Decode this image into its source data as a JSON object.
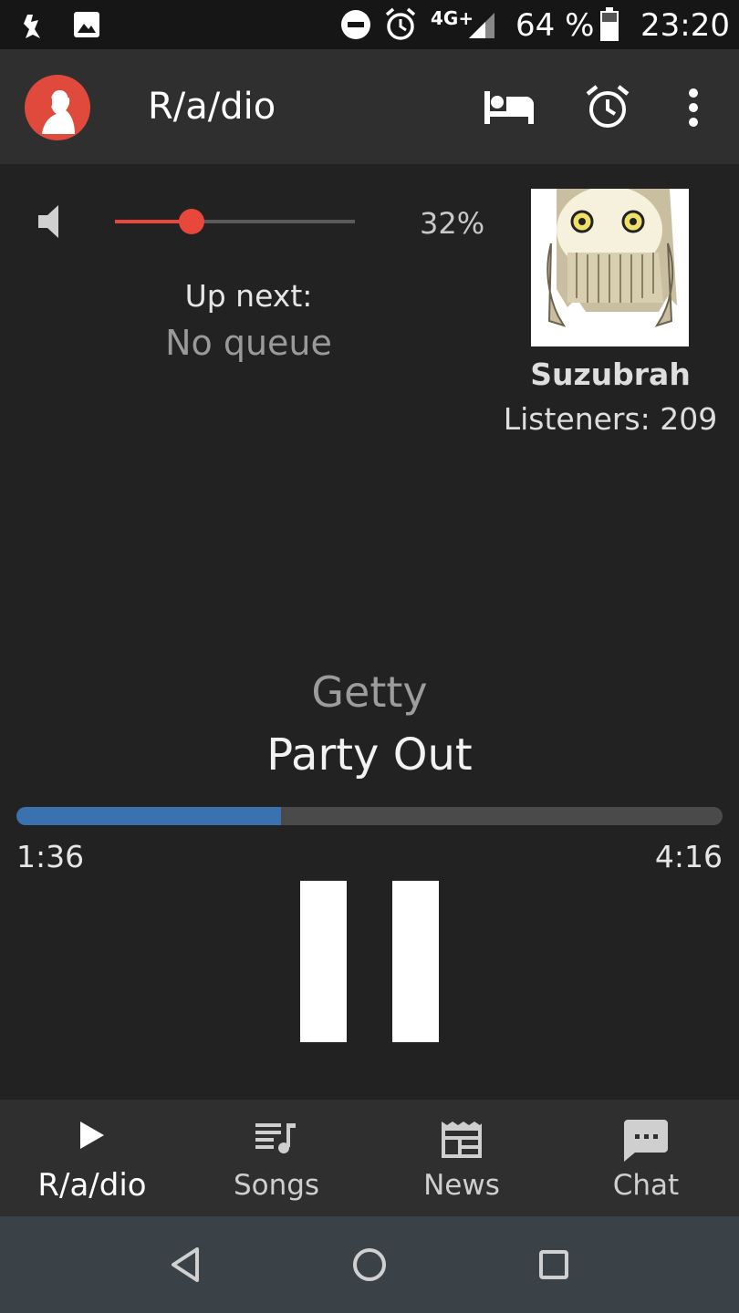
{
  "status_bar": {
    "battery_text": "64 %",
    "time": "23:20",
    "network": "4G+",
    "icons": [
      "notification-app-icon",
      "image-icon",
      "do-not-disturb-icon",
      "alarm-icon",
      "signal-icon",
      "battery-icon"
    ]
  },
  "app_bar": {
    "title": "R/a/dio",
    "icons": [
      "app-logo-icon",
      "sleep-bed-icon",
      "alarm-clock-icon",
      "more-vert-icon"
    ]
  },
  "volume": {
    "percent_text": "32%",
    "level": 0.32,
    "icon": "speaker-icon",
    "accent_color": "#e8473c"
  },
  "queue": {
    "label": "Up next:",
    "value": "No queue"
  },
  "dj": {
    "name": "Suzubrah",
    "listeners_text": "Listeners: 209"
  },
  "track": {
    "artist": "Getty",
    "title": "Party Out",
    "elapsed": "1:36",
    "total": "4:16",
    "progress": 0.375,
    "progress_color": "#3a72b0"
  },
  "bottom_nav": {
    "items": [
      {
        "label": "R/a/dio",
        "icon": "play-icon",
        "active": true
      },
      {
        "label": "Songs",
        "icon": "playlist-icon",
        "active": false
      },
      {
        "label": "News",
        "icon": "news-icon",
        "active": false
      },
      {
        "label": "Chat",
        "icon": "chat-icon",
        "active": false
      }
    ]
  },
  "system_nav": {
    "icons": [
      "back-icon",
      "home-icon",
      "recents-icon"
    ]
  }
}
